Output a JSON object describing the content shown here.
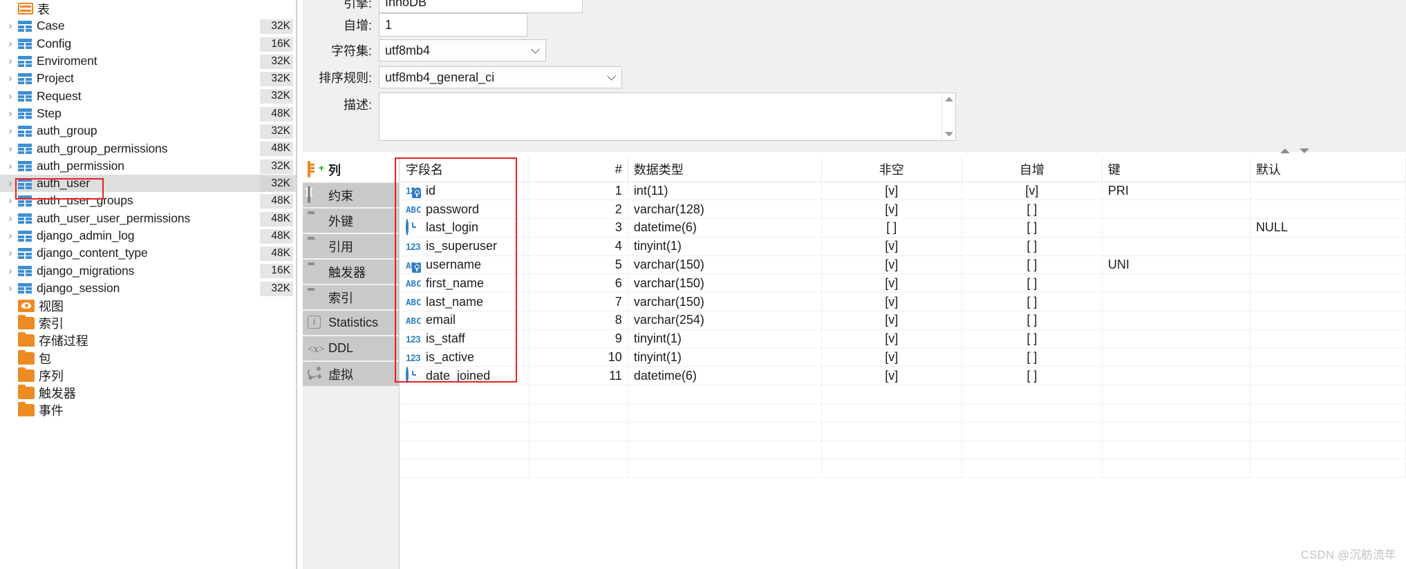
{
  "tree": {
    "root": {
      "label": "表",
      "icon": "table-root-icon"
    },
    "tables": [
      {
        "name": "Case",
        "size": "32K"
      },
      {
        "name": "Config",
        "size": "16K"
      },
      {
        "name": "Enviroment",
        "size": "32K"
      },
      {
        "name": "Project",
        "size": "32K"
      },
      {
        "name": "Request",
        "size": "32K"
      },
      {
        "name": "Step",
        "size": "48K"
      },
      {
        "name": "auth_group",
        "size": "32K"
      },
      {
        "name": "auth_group_permissions",
        "size": "48K"
      },
      {
        "name": "auth_permission",
        "size": "32K"
      },
      {
        "name": "auth_user",
        "size": "32K",
        "selected": true
      },
      {
        "name": "auth_user_groups",
        "size": "48K"
      },
      {
        "name": "auth_user_user_permissions",
        "size": "48K"
      },
      {
        "name": "django_admin_log",
        "size": "48K"
      },
      {
        "name": "django_content_type",
        "size": "48K"
      },
      {
        "name": "django_migrations",
        "size": "16K"
      },
      {
        "name": "django_session",
        "size": "32K"
      }
    ],
    "folders": [
      {
        "label": "视图",
        "icon": "eye-icon"
      },
      {
        "label": "索引",
        "icon": "folder-icon"
      },
      {
        "label": "存储过程",
        "icon": "folder-icon"
      },
      {
        "label": "包",
        "icon": "folder-icon"
      },
      {
        "label": "序列",
        "icon": "folder-icon"
      },
      {
        "label": "触发器",
        "icon": "folder-icon"
      },
      {
        "label": "事件",
        "icon": "folder-icon"
      }
    ]
  },
  "form": {
    "engine": {
      "label": "引擎:",
      "value": "InnoDB"
    },
    "auto_increment": {
      "label": "自增:",
      "value": "1"
    },
    "charset": {
      "label": "字符集:",
      "value": "utf8mb4"
    },
    "collation": {
      "label": "排序规则:",
      "value": "utf8mb4_general_ci"
    },
    "description": {
      "label": "描述:",
      "value": ""
    }
  },
  "tabs": [
    {
      "label": "列",
      "icon": "column-add-icon",
      "active": true
    },
    {
      "label": "约束",
      "icon": "constraint-icon",
      "active": false
    },
    {
      "label": "外键",
      "icon": "folder-icon",
      "active": false
    },
    {
      "label": "引用",
      "icon": "folder-icon",
      "active": false
    },
    {
      "label": "触发器",
      "icon": "folder-icon",
      "active": false
    },
    {
      "label": "索引",
      "icon": "folder-icon",
      "active": false
    },
    {
      "label": "Statistics",
      "icon": "info-icon",
      "active": false
    },
    {
      "label": "DDL",
      "icon": "ddl-icon",
      "active": false
    },
    {
      "label": "虚拟",
      "icon": "virtual-icon",
      "active": false
    }
  ],
  "grid": {
    "columns": [
      {
        "key": "name",
        "label": "字段名"
      },
      {
        "key": "num",
        "label": "#"
      },
      {
        "key": "type",
        "label": "数据类型"
      },
      {
        "key": "notnull",
        "label": "非空"
      },
      {
        "key": "autoinc",
        "label": "自增"
      },
      {
        "key": "keytype",
        "label": "键"
      },
      {
        "key": "default",
        "label": "默认"
      }
    ],
    "rows": [
      {
        "icon": "number-icon",
        "key_badge": true,
        "name": "id",
        "num": "1",
        "type": "int(11)",
        "notnull": "[v]",
        "autoinc": "[v]",
        "keytype": "PRI",
        "default": ""
      },
      {
        "icon": "text-icon",
        "key_badge": false,
        "name": "password",
        "num": "2",
        "type": "varchar(128)",
        "notnull": "[v]",
        "autoinc": "[ ]",
        "keytype": "",
        "default": ""
      },
      {
        "icon": "clock-icon",
        "key_badge": false,
        "name": "last_login",
        "num": "3",
        "type": "datetime(6)",
        "notnull": "[ ]",
        "autoinc": "[ ]",
        "keytype": "",
        "default": "NULL"
      },
      {
        "icon": "number-icon",
        "key_badge": false,
        "name": "is_superuser",
        "num": "4",
        "type": "tinyint(1)",
        "notnull": "[v]",
        "autoinc": "[ ]",
        "keytype": "",
        "default": ""
      },
      {
        "icon": "text-icon",
        "key_badge": true,
        "name": "username",
        "num": "5",
        "type": "varchar(150)",
        "notnull": "[v]",
        "autoinc": "[ ]",
        "keytype": "UNI",
        "default": ""
      },
      {
        "icon": "text-icon",
        "key_badge": false,
        "name": "first_name",
        "num": "6",
        "type": "varchar(150)",
        "notnull": "[v]",
        "autoinc": "[ ]",
        "keytype": "",
        "default": ""
      },
      {
        "icon": "text-icon",
        "key_badge": false,
        "name": "last_name",
        "num": "7",
        "type": "varchar(150)",
        "notnull": "[v]",
        "autoinc": "[ ]",
        "keytype": "",
        "default": ""
      },
      {
        "icon": "text-icon",
        "key_badge": false,
        "name": "email",
        "num": "8",
        "type": "varchar(254)",
        "notnull": "[v]",
        "autoinc": "[ ]",
        "keytype": "",
        "default": ""
      },
      {
        "icon": "number-icon",
        "key_badge": false,
        "name": "is_staff",
        "num": "9",
        "type": "tinyint(1)",
        "notnull": "[v]",
        "autoinc": "[ ]",
        "keytype": "",
        "default": ""
      },
      {
        "icon": "number-icon",
        "key_badge": false,
        "name": "is_active",
        "num": "10",
        "type": "tinyint(1)",
        "notnull": "[v]",
        "autoinc": "[ ]",
        "keytype": "",
        "default": ""
      },
      {
        "icon": "clock-icon",
        "key_badge": false,
        "name": "date_joined",
        "num": "11",
        "type": "datetime(6)",
        "notnull": "[v]",
        "autoinc": "[ ]",
        "keytype": "",
        "default": ""
      }
    ]
  },
  "watermark": "CSDN @沉舫流年",
  "colors": {
    "accent_orange": "#ee8a22",
    "table_blue": "#3d8fd4",
    "highlight_red": "#e81f1f",
    "selection_gray": "#dedede"
  }
}
